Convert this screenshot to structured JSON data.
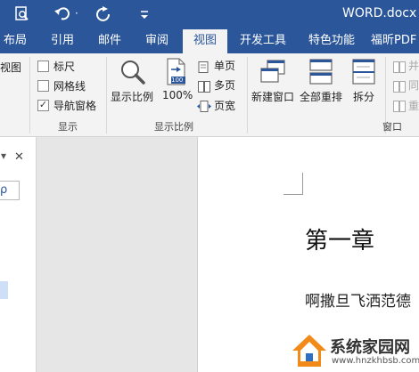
{
  "titlebar": {
    "document_title": "WORD.docx -",
    "qat_more": "·",
    "undo_dropdown": "·"
  },
  "tabs": [
    {
      "label": "布局"
    },
    {
      "label": "引用"
    },
    {
      "label": "邮件"
    },
    {
      "label": "审阅"
    },
    {
      "label": "视图",
      "active": true
    },
    {
      "label": "开发工具"
    },
    {
      "label": "特色功能"
    },
    {
      "label": "福昕PDF"
    }
  ],
  "ribbon": {
    "views_partial": "视图",
    "show_group": {
      "label": "显示",
      "ruler": {
        "label": "标尺",
        "checked": false
      },
      "gridlines": {
        "label": "网格线",
        "checked": false
      },
      "nav_pane": {
        "label": "导航窗格",
        "checked": true,
        "mark": "✓"
      }
    },
    "zoom_group": {
      "label": "显示比例",
      "zoom": "显示比例",
      "hundred": "100%",
      "hundred_badge": "100",
      "one_page": "单页",
      "multi_page": "多页",
      "page_width": "页宽"
    },
    "window_group": {
      "label": "窗口",
      "new_window": "新建窗口",
      "arrange_all": "全部重排",
      "split": "拆分",
      "side_by_side_partial": "并",
      "sync_scroll_partial": "同",
      "reset_pos_partial": "重"
    }
  },
  "nav_pane": {
    "menu_arrow": "▾",
    "close": "✕",
    "search_partial": "ρ"
  },
  "document": {
    "heading": "第一章",
    "body_text": "啊撒旦飞洒范德"
  },
  "watermark": {
    "title": "系统家园网",
    "url": "www.hnzkhbsb.com"
  },
  "colors": {
    "accent": "#2b579a",
    "ribbon": "#f3f3f3",
    "watermark_orange": "#f28a1a"
  }
}
